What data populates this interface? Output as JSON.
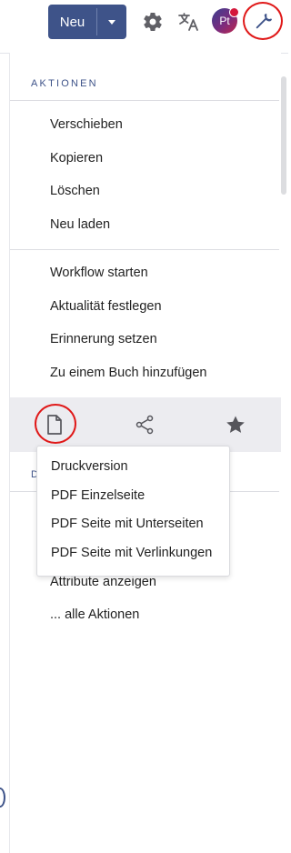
{
  "toolbar": {
    "new_label": "Neu",
    "avatar_initials": "Pt",
    "icons": [
      "caret-down-icon",
      "gear-icon",
      "translate-icon",
      "avatar",
      "wrench-icon"
    ],
    "highlight_color": "#e01919",
    "accent_color": "#3e5389"
  },
  "panel": {
    "section_title": "AKTIONEN",
    "group1": [
      "Verschieben",
      "Kopieren",
      "Löschen",
      "Neu laden"
    ],
    "group2": [
      "Workflow starten",
      "Aktualität festlegen",
      "Erinnerung setzen",
      "Zu einem Buch hinzufügen"
    ],
    "iconbar": [
      "file-icon",
      "share-icon",
      "star-icon"
    ],
    "truncated_section": "D",
    "group3": [
      "Attribute anzeigen",
      "... alle Aktionen"
    ]
  },
  "dropdown": {
    "items": [
      "Druckversion",
      "PDF Einzelseite",
      "PDF Seite mit Unterseiten",
      "PDF Seite mit Verlinkungen"
    ]
  }
}
